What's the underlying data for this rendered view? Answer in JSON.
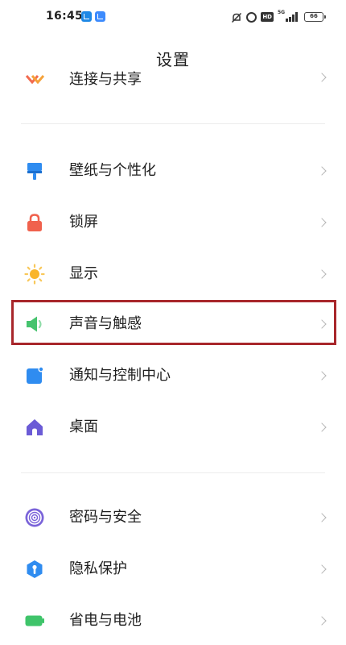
{
  "status_bar": {
    "time": "16:45",
    "network": "5G",
    "battery": "66"
  },
  "header": {
    "title": "设置"
  },
  "partial_item": {
    "label": "连接与共享"
  },
  "groups": [
    {
      "items": [
        {
          "key": "wallpaper",
          "label": "壁纸与个性化",
          "icon": "brush-icon",
          "color": "#2f8cf0"
        },
        {
          "key": "lockscreen",
          "label": "锁屏",
          "icon": "lock-icon",
          "color": "#f0614d"
        },
        {
          "key": "display",
          "label": "显示",
          "icon": "sun-icon",
          "color": "#f9b52b"
        },
        {
          "key": "sound",
          "label": "声音与触感",
          "icon": "speaker-icon",
          "color": "#46c36e",
          "highlighted": true
        },
        {
          "key": "notifications",
          "label": "通知与控制中心",
          "icon": "notification-icon",
          "color": "#2f8cf0"
        },
        {
          "key": "home",
          "label": "桌面",
          "icon": "home-icon",
          "color": "#6b5bd6"
        }
      ]
    },
    {
      "items": [
        {
          "key": "security",
          "label": "密码与安全",
          "icon": "fingerprint-icon",
          "color": "#7a63d9"
        },
        {
          "key": "privacy",
          "label": "隐私保护",
          "icon": "shield-icon",
          "color": "#2f8cf0"
        },
        {
          "key": "battery",
          "label": "省电与电池",
          "icon": "battery-icon",
          "color": "#3fc46a"
        }
      ]
    }
  ],
  "highlight_color": "#a8262b"
}
